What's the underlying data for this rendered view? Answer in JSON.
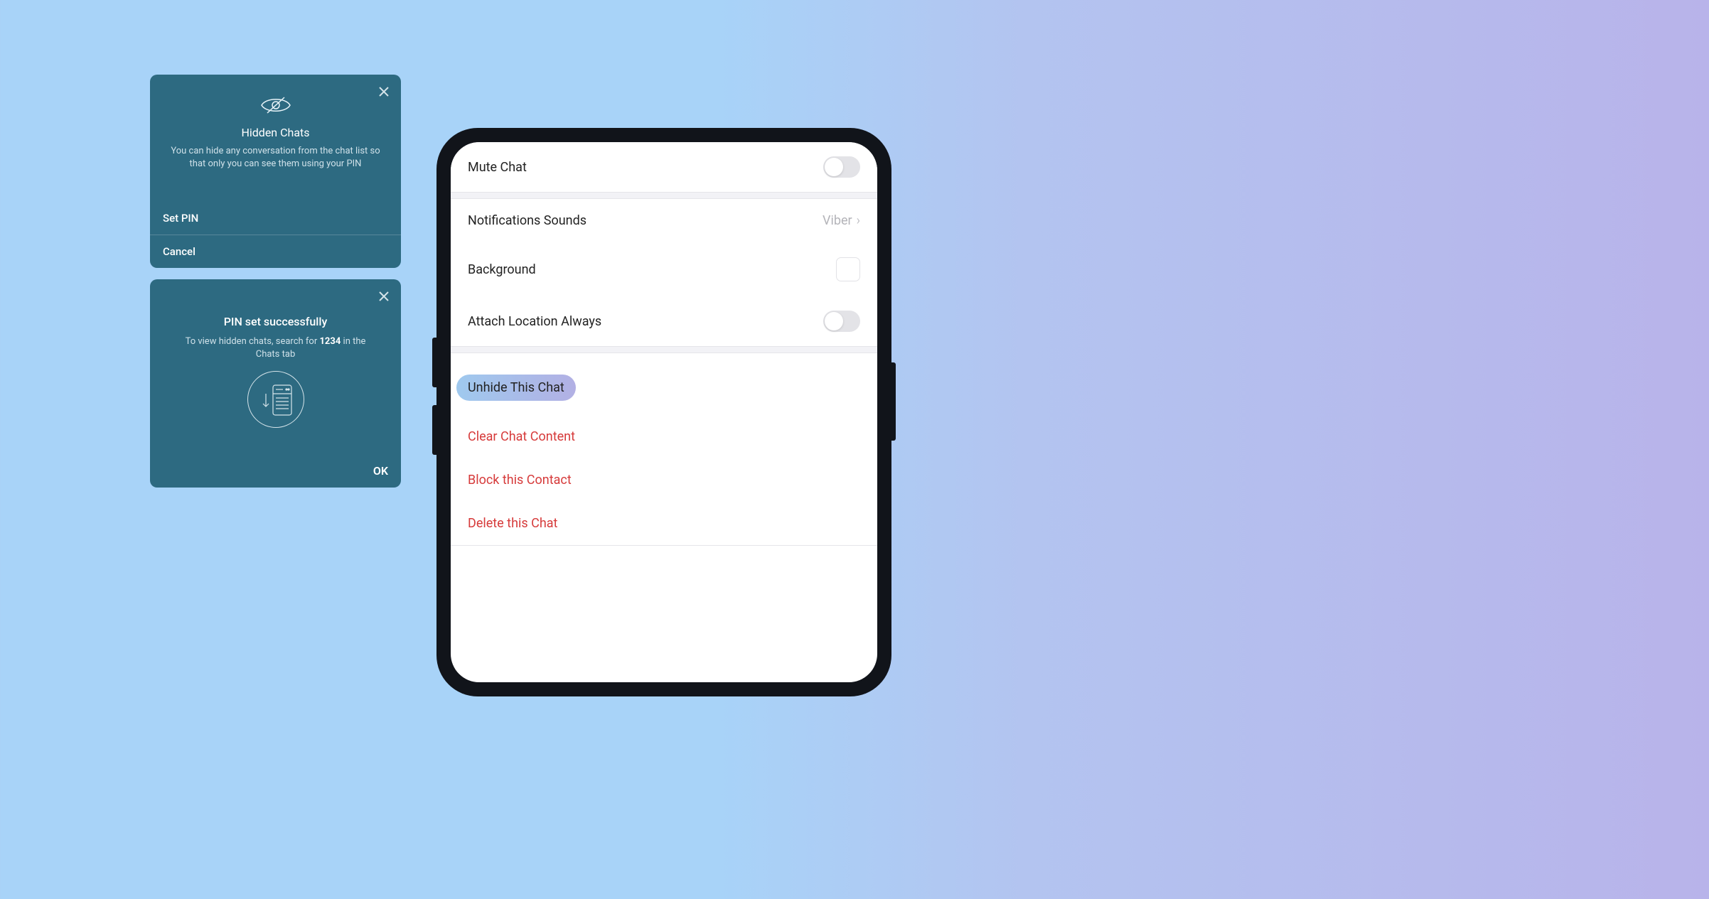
{
  "dialog1": {
    "title": "Hidden Chats",
    "description": "You can hide any conversation from the chat list so that only you can see them using your PIN",
    "actions": {
      "set_pin": "Set PIN",
      "cancel": "Cancel"
    }
  },
  "dialog2": {
    "title": "PIN set successfully",
    "desc_prefix": "To view hidden chats, search for ",
    "pin": "1234",
    "desc_suffix": " in the Chats tab",
    "ok": "OK"
  },
  "settings": {
    "mute_chat": "Mute Chat",
    "notification_sounds": "Notifications Sounds",
    "notification_value": "Viber",
    "background": "Background",
    "attach_location": "Attach Location Always"
  },
  "actions": {
    "unhide": "Unhide This Chat",
    "clear": "Clear Chat Content",
    "block": "Block this Contact",
    "delete": "Delete this Chat"
  }
}
